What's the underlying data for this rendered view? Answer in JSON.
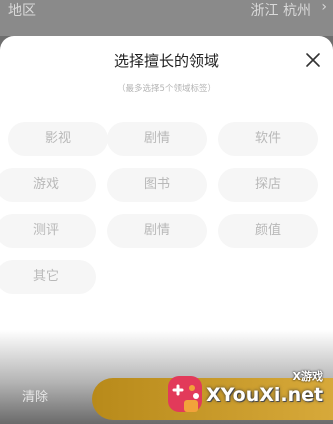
{
  "background_row": {
    "label": "地区",
    "value": "浙江 杭州",
    "chevron_icon": "chevron-right-icon"
  },
  "sheet": {
    "title": "选择擅长的领域",
    "subtitle": "（最多选择5个领域标签）",
    "close_icon": "close-icon"
  },
  "tags": [
    {
      "label": "影视"
    },
    {
      "label": "剧情"
    },
    {
      "label": "软件"
    },
    {
      "label": "游戏"
    },
    {
      "label": "图书"
    },
    {
      "label": "探店"
    },
    {
      "label": "测评"
    },
    {
      "label": "剧情"
    },
    {
      "label": "颜值"
    },
    {
      "label": "其它"
    }
  ],
  "footer": {
    "clear_label": "清除",
    "confirm_label": ""
  },
  "watermark": {
    "small_text": "X游戏",
    "big_text": "XYouXi.net",
    "logo_colors": [
      "#e23a5a",
      "#f2a23a",
      "#ffffff"
    ]
  }
}
